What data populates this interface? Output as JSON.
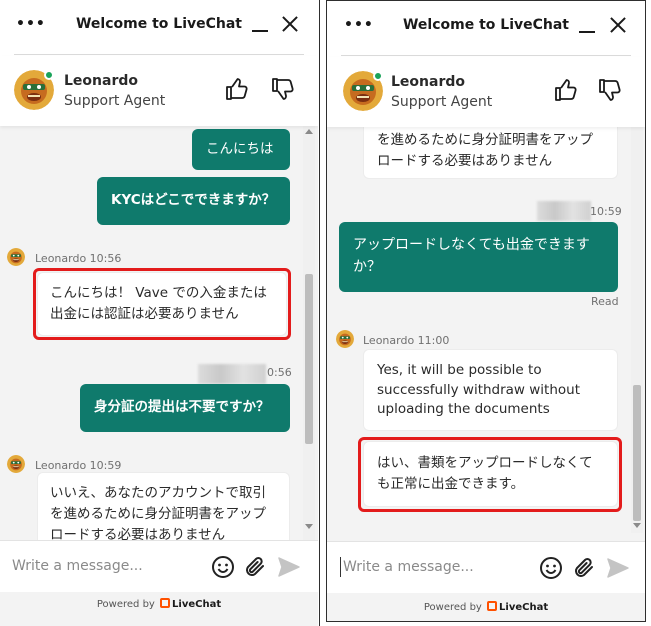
{
  "colors": {
    "accent": "#0f7a6c",
    "highlight": "#e31b1b",
    "online": "#1aa35a",
    "brand": "#ff5100"
  },
  "icons": {
    "menu": "more-horizontal",
    "minimize": "minimize",
    "close": "close",
    "rate_good": "thumbs-up",
    "rate_bad": "thumbs-down",
    "emoji": "smile",
    "attach": "paperclip",
    "send": "send-arrow"
  },
  "header": {
    "menu_icon": "•••",
    "title": "Welcome to LiveChat"
  },
  "agent": {
    "name": "Leonardo",
    "role": "Support Agent"
  },
  "composer": {
    "placeholder": "Write a message..."
  },
  "footer": {
    "powered_by": "Powered by",
    "brand": "LiveChat"
  },
  "left_panel": {
    "messages": {
      "m1": "こんにちは",
      "m2": "KYCはどこでできますか？",
      "agent_meta_1": "Leonardo 10:56",
      "m3": "こんにちは！ Vave での入金または出金には認証は必要ありません",
      "time_partial": "0:56",
      "m4": "身分証の提出は不要ですか？",
      "agent_meta_2": "Leonardo 10:59",
      "m5": "いいえ、あなたのアカウントで取引を進めるために身分証明書をアップロードする必要はありません"
    }
  },
  "right_panel": {
    "messages": {
      "m5_tail": "を進めるために身分証明書をアップロードする必要はありません",
      "time_partial": "10:59",
      "m6": "アップロードしなくても出金できますか？",
      "status": "Read",
      "agent_meta": "Leonardo 11:00",
      "m7": "Yes, it will be possible to successfully withdraw without uploading the documents",
      "m8": "はい、書類をアップロードしなくても正常に出金できます。"
    }
  }
}
